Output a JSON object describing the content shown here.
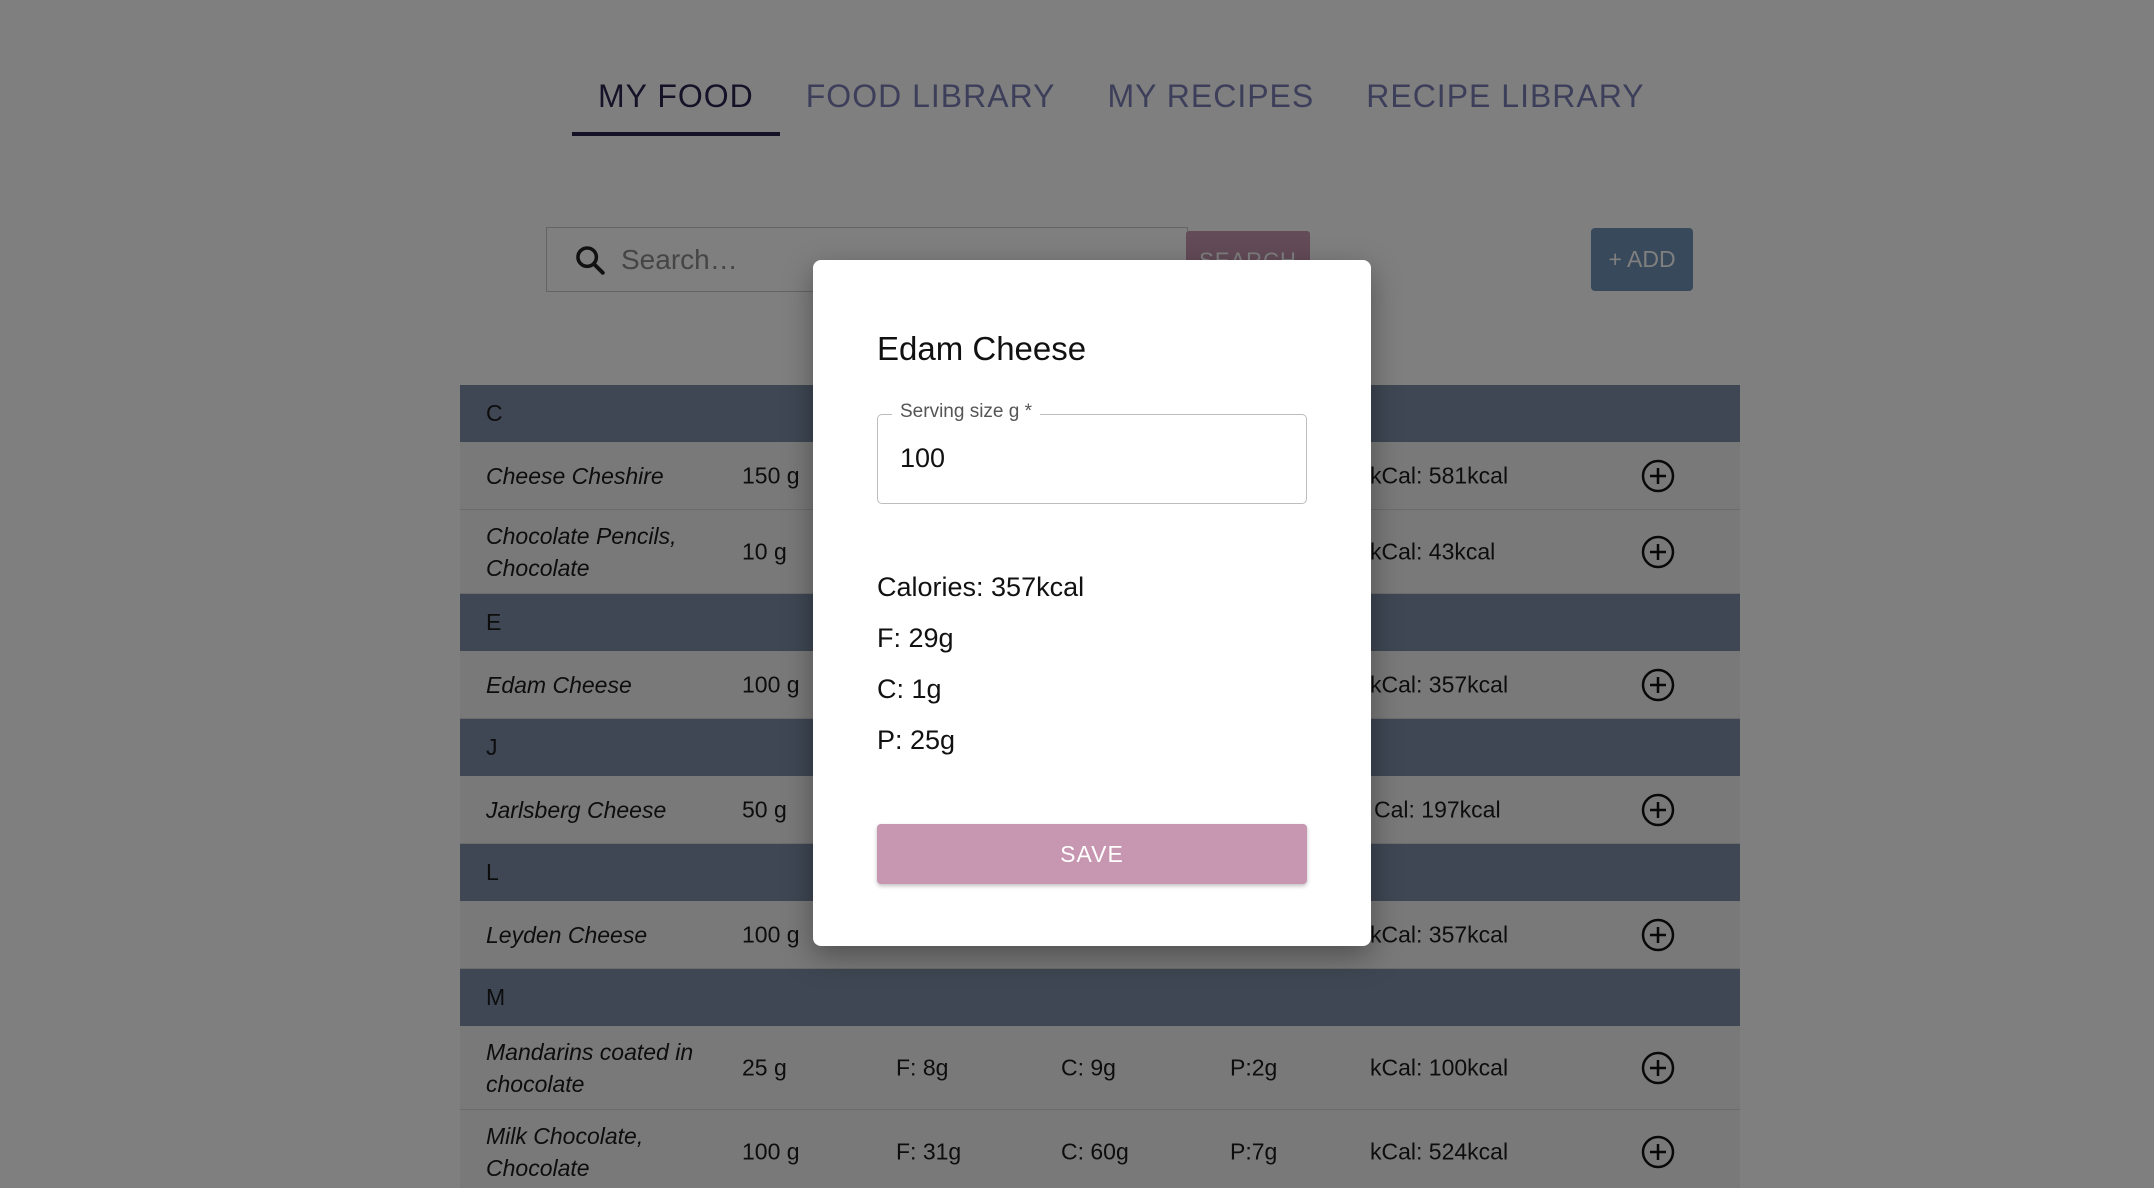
{
  "tabs": [
    {
      "label": "MY FOOD",
      "active": true
    },
    {
      "label": "FOOD LIBRARY",
      "active": false
    },
    {
      "label": "MY RECIPES",
      "active": false
    },
    {
      "label": "RECIPE LIBRARY",
      "active": false
    }
  ],
  "search": {
    "placeholder": "Search…",
    "button_label": "SEARCH"
  },
  "add_button_label": "+ ADD",
  "groups": [
    {
      "letter": "C",
      "rows": [
        {
          "name": "Cheese Cheshire",
          "serving": "150 g",
          "f": "",
          "c": "",
          "p": "",
          "kcal": "kCal: 581kcal"
        },
        {
          "name": "Chocolate Pencils, Chocolate",
          "serving": "10 g",
          "f": "",
          "c": "",
          "p": "",
          "kcal": "kCal: 43kcal"
        }
      ]
    },
    {
      "letter": "E",
      "rows": [
        {
          "name": "Edam Cheese",
          "serving": "100 g",
          "f": "",
          "c": "",
          "p": "",
          "kcal": "kCal: 357kcal"
        }
      ]
    },
    {
      "letter": "J",
      "rows": [
        {
          "name": "Jarlsberg Cheese",
          "serving": "50 g",
          "f": "",
          "c": "",
          "p": "",
          "kcal": "Cal: 197kcal"
        }
      ]
    },
    {
      "letter": "L",
      "rows": [
        {
          "name": "Leyden Cheese",
          "serving": "100 g",
          "f": "",
          "c": "",
          "p": "",
          "kcal": "kCal: 357kcal"
        }
      ]
    },
    {
      "letter": "M",
      "rows": [
        {
          "name": "Mandarins coated in chocolate",
          "serving": "25 g",
          "f": "F: 8g",
          "c": "C: 9g",
          "p": "P:2g",
          "kcal": "kCal: 100kcal"
        },
        {
          "name": "Milk Chocolate, Chocolate",
          "serving": "100 g",
          "f": "F: 31g",
          "c": "C: 60g",
          "p": "P:7g",
          "kcal": "kCal: 524kcal"
        }
      ]
    }
  ],
  "modal": {
    "title": "Edam Cheese",
    "serving_label": "Serving size g *",
    "serving_value": "100",
    "calories": "Calories: 357kcal",
    "fat": "F: 29g",
    "carbs": "C: 1g",
    "protein": "P: 25g",
    "save_label": "SAVE"
  },
  "colors": {
    "accent_pink": "#c796b0",
    "add_blue": "#6f93b5",
    "group_header": "#7d8ea6",
    "tab_active": "#2a2450",
    "tab_inactive": "#7a7fb5"
  }
}
